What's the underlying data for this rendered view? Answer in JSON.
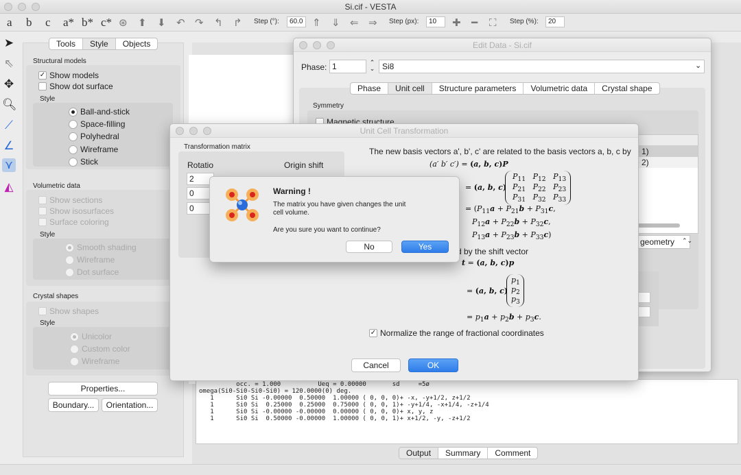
{
  "app": {
    "window_title": "Si.cif - VESTA"
  },
  "toolbar": {
    "axis_buttons": [
      "a",
      "b",
      "c",
      "a*",
      "b*",
      "c*"
    ],
    "step_deg_label": "Step (°):",
    "step_deg_value": "60.0",
    "step_px_label": "Step (px):",
    "step_px_value": "10",
    "step_pct_label": "Step (%):",
    "step_pct_value": "20"
  },
  "side_panel": {
    "tabs": [
      "Tools",
      "Style",
      "Objects"
    ],
    "structural_models": {
      "heading": "Structural models",
      "show_models": "Show models",
      "show_dot_surface": "Show dot surface",
      "style_label": "Style",
      "styles": [
        "Ball-and-stick",
        "Space-filling",
        "Polyhedral",
        "Wireframe",
        "Stick"
      ]
    },
    "volumetric_data": {
      "heading": "Volumetric data",
      "show_sections": "Show sections",
      "show_isosurfaces": "Show isosurfaces",
      "surface_coloring": "Surface coloring",
      "style_label": "Style",
      "styles": [
        "Smooth shading",
        "Wireframe",
        "Dot surface"
      ]
    },
    "crystal_shapes": {
      "heading": "Crystal shapes",
      "show_shapes": "Show shapes",
      "style_label": "Style",
      "styles": [
        "Unicolor",
        "Custom color",
        "Wireframe"
      ]
    },
    "properties_button": "Properties...",
    "boundary_button": "Boundary...",
    "orientation_button": "Orientation..."
  },
  "output": {
    "lines": [
      "          occ. = 1.000          Ueq = 0.00000       sd     =5ø",
      "",
      "omega(Si0-Si0-Si0-Si0) = 120.0000(0) deg.",
      "   1      Si0 Si -0.00000  0.50000  1.00000 ( 0, 0, 0)+ -x, -y+1/2, z+1/2",
      "   1      Si0 Si  0.25000  0.25000  0.75000 ( 0, 0, 1)+ -y+1/4, -x+1/4, -z+1/4",
      "   1      Si0 Si -0.00000 -0.00000  0.00000 ( 0, 0, 0)+ x, y, z",
      "   1      Si0 Si  0.50000 -0.00000  1.00000 ( 0, 0, 1)+ x+1/2, -y, -z+1/2"
    ],
    "tabs": [
      "Output",
      "Summary",
      "Comment"
    ]
  },
  "edit_data": {
    "title": "Edit Data - Si.cif",
    "phase_label": "Phase:",
    "phase_value": "1",
    "phase_name": "Si8",
    "tabs": [
      "Phase",
      "Unit cell",
      "Structure parameters",
      "Volumetric data",
      "Crystal shape"
    ],
    "symmetry_label": "Symmetry",
    "magnetic_structure": "Magnetic structure",
    "list_items": [
      "e 1)",
      "e 2)"
    ],
    "geometry_select": "geometry"
  },
  "unit_cell_dialog": {
    "title": "Unit Cell Transformation",
    "matrix_label": "Transformation matrix",
    "column_header_partial": "Rotatio",
    "column_header_partial2": "Origin shift",
    "matrix_values": [
      "2",
      "0",
      "0"
    ],
    "intro": "The new basis vectors a', b', c' are related to the basis vectors a, b, c by",
    "shift_text": "d by the shift vector",
    "normalize_label": "Normalize the range of fractional coordinates",
    "cancel_button": "Cancel",
    "ok_button": "OK"
  },
  "warning": {
    "title": "Warning !",
    "message": "The matrix you have given changes the unit cell volume.",
    "question": "Are you sure you want to continue?",
    "no_button": "No",
    "yes_button": "Yes"
  },
  "colors": {
    "accent_blue": "#2f7de9",
    "atom_red": "#d9261c",
    "atom_orange": "#f39a3c",
    "atom_blue": "#2a6bd9"
  }
}
